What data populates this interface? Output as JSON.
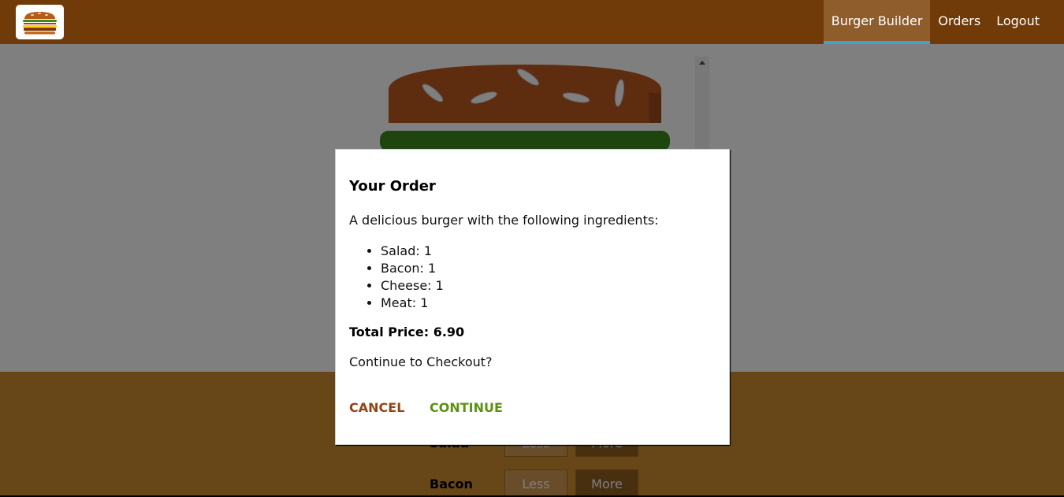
{
  "nav": {
    "items": [
      {
        "label": "Burger Builder",
        "active": true
      },
      {
        "label": "Orders",
        "active": false
      },
      {
        "label": "Logout",
        "active": false
      }
    ]
  },
  "controls": {
    "rows": [
      {
        "label": "Salad",
        "less": "Less",
        "more": "More"
      },
      {
        "label": "Bacon",
        "less": "Less",
        "more": "More"
      }
    ]
  },
  "modal": {
    "title": "Your Order",
    "description": "A delicious burger with the following ingredients:",
    "ingredients": [
      "Salad: 1",
      "Bacon: 1",
      "Cheese: 1",
      "Meat: 1"
    ],
    "total": "Total Price: 6.90",
    "question": "Continue to Checkout?",
    "cancel": "CANCEL",
    "continue": "CONTINUE"
  },
  "colors": {
    "toolbar": "#703B09",
    "controls": "#CF8F2E",
    "cancel": "#944317",
    "continue": "#5C9210",
    "active_underline": "#40A4C8"
  }
}
